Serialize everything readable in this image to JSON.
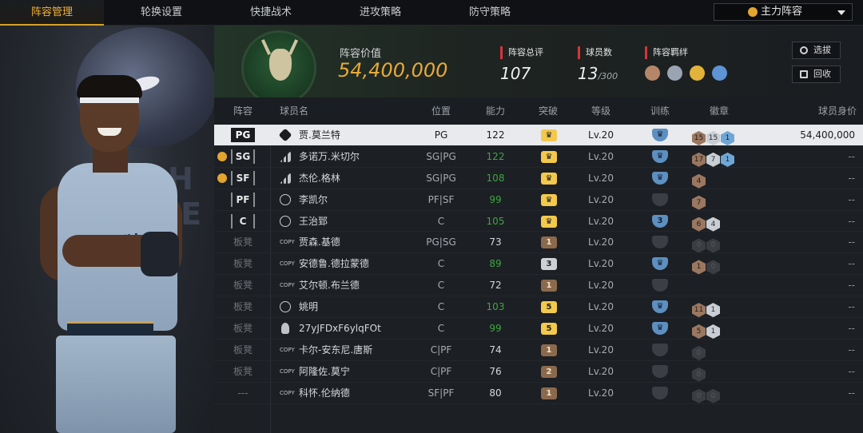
{
  "tabs": [
    "阵容管理",
    "轮换设置",
    "快捷战术",
    "进攻策略",
    "防守策略"
  ],
  "lineup_select": "主力阵容",
  "summary": {
    "value_title": "阵容价值",
    "value": "54,400,000",
    "rating_label": "阵容总评",
    "rating": "107",
    "count_label": "球员数",
    "count": "13",
    "count_max": "/300",
    "bond_label": "阵容羁绊",
    "bond_colors": [
      "#b5866a",
      "#9aa4b3",
      "#e2b33a",
      "#5e93d4"
    ],
    "select_btn": "选拔",
    "recycle_btn": "回收"
  },
  "headers": {
    "lineup": "阵容",
    "name": "球员名",
    "pos": "位置",
    "ability": "能力",
    "breakthrough": "突破",
    "level": "等级",
    "training": "训练",
    "badges": "徽章",
    "worth": "球员身价"
  },
  "players": [
    {
      "slot": "PG",
      "tier": "bars-dark",
      "name": "贾.莫兰特",
      "pos": "PG",
      "ability": "122",
      "ability_color": "white",
      "break": "gold",
      "break_text": "♛",
      "level": "Lv.20",
      "train": "blue",
      "train_text": "♛",
      "badges": [
        [
          "br",
          "15"
        ],
        [
          "sv",
          "15"
        ],
        [
          "bl",
          "1"
        ]
      ],
      "worth": "54,400,000",
      "alarm": false,
      "selected": true
    },
    {
      "slot": "SG",
      "tier": "bars",
      "name": "多诺万.米切尔",
      "pos": "SG|PG",
      "ability": "122",
      "ability_color": "green",
      "break": "gold",
      "break_text": "♛",
      "level": "Lv.20",
      "train": "blue",
      "train_text": "♛",
      "badges": [
        [
          "br",
          "17"
        ],
        [
          "sv",
          "7"
        ],
        [
          "bl",
          "1"
        ]
      ],
      "worth": "--",
      "alarm": true,
      "selected": false
    },
    {
      "slot": "SF",
      "tier": "bars",
      "name": "杰伦.格林",
      "pos": "SG|PG",
      "ability": "108",
      "ability_color": "green",
      "break": "gold",
      "break_text": "♛",
      "level": "Lv.20",
      "train": "blue",
      "train_text": "♛",
      "badges": [
        [
          "br",
          "4"
        ]
      ],
      "worth": "--",
      "alarm": true,
      "selected": false
    },
    {
      "slot": "PF",
      "tier": "star",
      "name": "李凯尔",
      "pos": "PF|SF",
      "ability": "99",
      "ability_color": "green",
      "break": "gold",
      "break_text": "♛",
      "level": "Lv.20",
      "train": "grey",
      "train_text": "",
      "badges": [
        [
          "br",
          "7"
        ]
      ],
      "worth": "--",
      "alarm": false,
      "selected": false
    },
    {
      "slot": "C",
      "tier": "star",
      "name": "王治郅",
      "pos": "C",
      "ability": "105",
      "ability_color": "green",
      "break": "gold",
      "break_text": "♛",
      "level": "Lv.20",
      "train": "blue",
      "train_text": "3",
      "badges": [
        [
          "br",
          "6"
        ],
        [
          "sv",
          "4"
        ]
      ],
      "worth": "--",
      "alarm": false,
      "selected": false
    },
    {
      "slot": "板凳",
      "tier": "copy",
      "name": "贾森.基德",
      "pos": "PG|SG",
      "ability": "73",
      "ability_color": "white",
      "break": "bronze",
      "break_text": "1",
      "level": "Lv.20",
      "train": "grey",
      "train_text": "",
      "badges": [
        [
          "dk",
          "0"
        ],
        [
          "dk",
          "0"
        ]
      ],
      "worth": "--",
      "alarm": false,
      "selected": false
    },
    {
      "slot": "板凳",
      "tier": "copy",
      "name": "安德鲁.德拉蒙德",
      "pos": "C",
      "ability": "89",
      "ability_color": "green",
      "break": "silver",
      "break_text": "3",
      "level": "Lv.20",
      "train": "blue",
      "train_text": "♛",
      "badges": [
        [
          "br",
          "1"
        ],
        [
          "dk",
          "0"
        ]
      ],
      "worth": "--",
      "alarm": false,
      "selected": false
    },
    {
      "slot": "板凳",
      "tier": "copy",
      "name": "艾尔顿.布兰德",
      "pos": "C",
      "ability": "72",
      "ability_color": "white",
      "break": "bronze",
      "break_text": "1",
      "level": "Lv.20",
      "train": "grey",
      "train_text": "",
      "badges": [],
      "worth": "--",
      "alarm": false,
      "selected": false
    },
    {
      "slot": "板凳",
      "tier": "star",
      "name": "姚明",
      "pos": "C",
      "ability": "103",
      "ability_color": "green",
      "break": "gold",
      "break_text": "5",
      "level": "Lv.20",
      "train": "blue",
      "train_text": "♛",
      "badges": [
        [
          "br",
          "11"
        ],
        [
          "sv",
          "1"
        ]
      ],
      "worth": "--",
      "alarm": false,
      "selected": false
    },
    {
      "slot": "板凳",
      "tier": "person",
      "name": "27yJFDxF6ylqFOt",
      "pos": "C",
      "ability": "99",
      "ability_color": "green",
      "break": "gold",
      "break_text": "5",
      "level": "Lv.20",
      "train": "blue",
      "train_text": "♛",
      "badges": [
        [
          "br",
          "5"
        ],
        [
          "sv",
          "1"
        ]
      ],
      "worth": "--",
      "alarm": false,
      "selected": false
    },
    {
      "slot": "板凳",
      "tier": "copy",
      "name": "卡尔-安东尼.唐斯",
      "pos": "C|PF",
      "ability": "74",
      "ability_color": "white",
      "break": "bronze",
      "break_text": "1",
      "level": "Lv.20",
      "train": "grey",
      "train_text": "",
      "badges": [
        [
          "dk",
          "0"
        ]
      ],
      "worth": "--",
      "alarm": false,
      "selected": false
    },
    {
      "slot": "板凳",
      "tier": "copy",
      "name": "阿隆佐.莫宁",
      "pos": "C|PF",
      "ability": "76",
      "ability_color": "white",
      "break": "bronze",
      "break_text": "2",
      "level": "Lv.20",
      "train": "grey",
      "train_text": "",
      "badges": [
        [
          "dk",
          "0"
        ]
      ],
      "worth": "--",
      "alarm": false,
      "selected": false
    },
    {
      "slot": "---",
      "tier": "copy",
      "name": "科怀.伦纳德",
      "pos": "SF|PF",
      "ability": "80",
      "ability_color": "white",
      "break": "bronze",
      "break_text": "1",
      "level": "Lv.20",
      "train": "grey",
      "train_text": "",
      "badges": [
        [
          "dk",
          "0"
        ],
        [
          "dk",
          "0"
        ]
      ],
      "worth": "--",
      "alarm": false,
      "selected": false
    }
  ]
}
